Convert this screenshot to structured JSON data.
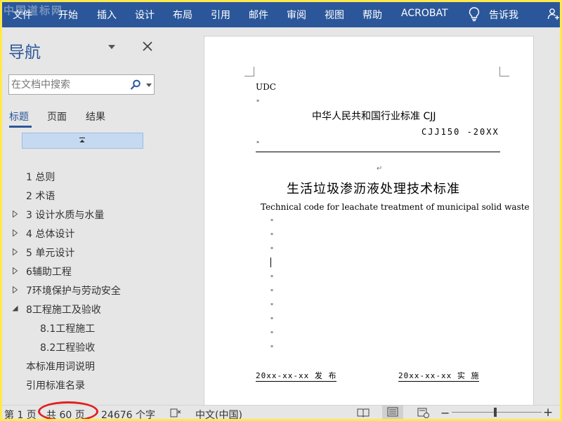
{
  "watermark": "中国道标网",
  "ribbon": {
    "tabs": [
      "文件",
      "开始",
      "插入",
      "设计",
      "布局",
      "引用",
      "邮件",
      "审阅",
      "视图",
      "帮助",
      "ACROBAT"
    ],
    "tell_me": "告诉我"
  },
  "nav": {
    "title": "导航",
    "search_placeholder": "在文档中搜索",
    "tabs": [
      "标题",
      "页面",
      "结果"
    ],
    "headings": [
      {
        "label": "1 总则",
        "level": 1,
        "arrow": "none"
      },
      {
        "label": "2 术语",
        "level": 1,
        "arrow": "none"
      },
      {
        "label": "3  设计水质与水量",
        "level": 1,
        "arrow": "collapsed"
      },
      {
        "label": "4  总体设计",
        "level": 1,
        "arrow": "collapsed"
      },
      {
        "label": "5  单元设计",
        "level": 1,
        "arrow": "collapsed"
      },
      {
        "label": "6辅助工程",
        "level": 1,
        "arrow": "collapsed"
      },
      {
        "label": "7环境保护与劳动安全",
        "level": 1,
        "arrow": "collapsed"
      },
      {
        "label": "8工程施工及验收",
        "level": 1,
        "arrow": "expanded"
      },
      {
        "label": "8.1工程施工",
        "level": 2,
        "arrow": "none"
      },
      {
        "label": "8.2工程验收",
        "level": 2,
        "arrow": "none"
      },
      {
        "label": "本标准用词说明",
        "level": 1,
        "arrow": "none"
      },
      {
        "label": "引用标准名录",
        "level": 1,
        "arrow": "none"
      }
    ]
  },
  "document": {
    "udc": "UDC",
    "header_line": "中华人民共和国行业标准 CJJ",
    "code": "CJJ150 -20XX",
    "title_cn": "生活垃圾渗沥液处理技术标准",
    "title_en": "Technical code for leachate treatment of municipal solid waste",
    "publish": "20xx-xx-xx 发 布",
    "implement": "20xx-xx-xx 实 施"
  },
  "status": {
    "page": "第 1 页",
    "total_pages": "共 60 页",
    "words": "24676 个字",
    "language": "中文(中国)",
    "zoom_minus": "−",
    "zoom_plus": "+"
  },
  "colors": {
    "ribbon": "#2b579a",
    "accent": "#2b579a",
    "highlight_oval": "#e02020",
    "frame": "#ffe84a"
  },
  "icons": [
    "lightbulb-icon",
    "share-icon",
    "search-icon",
    "close-icon",
    "chevron-down-icon",
    "collapse-all-icon",
    "focus-mode-icon",
    "read-mode-icon",
    "print-layout-icon",
    "web-layout-icon"
  ]
}
